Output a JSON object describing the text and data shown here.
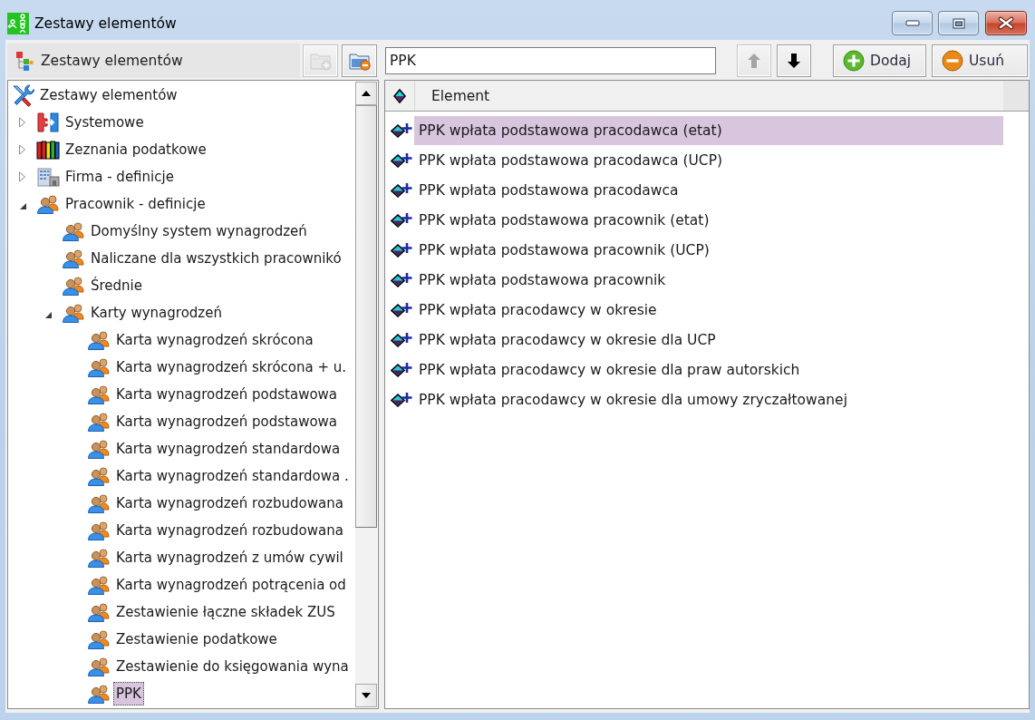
{
  "window": {
    "title": "Zestawy elementów"
  },
  "tree_panel": {
    "header": "Zestawy elementów",
    "buttons": [
      {
        "kind": "add",
        "disabled": true
      },
      {
        "kind": "remove",
        "disabled": false
      }
    ]
  },
  "tree": {
    "items": [
      {
        "label": "Zestawy elementów",
        "kind": "tools",
        "selected": false,
        "children": [
          {
            "label": "Systemowe",
            "kind": "system",
            "expanded": false,
            "selected": false
          },
          {
            "label": "Zeznania podatkowe",
            "kind": "books",
            "expanded": false,
            "selected": false
          },
          {
            "label": "Firma - definicje",
            "kind": "building",
            "expanded": false,
            "selected": false
          },
          {
            "label": "Pracownik - definicje",
            "kind": "people",
            "expanded": true,
            "selected": false,
            "children": [
              {
                "label": "Domyślny system wynagrodzeń",
                "kind": "people",
                "selected": false
              },
              {
                "label": "Naliczane dla wszystkich pracownikó",
                "kind": "people",
                "selected": false
              },
              {
                "label": "Średnie",
                "kind": "people",
                "selected": false
              },
              {
                "label": "Karty wynagrodzeń",
                "kind": "people",
                "expanded": true,
                "selected": false,
                "children": [
                  {
                    "label": "Karta wynagrodzeń skrócona",
                    "kind": "people",
                    "selected": false
                  },
                  {
                    "label": "Karta wynagrodzeń skrócona + u.",
                    "kind": "people",
                    "selected": false
                  },
                  {
                    "label": "Karta wynagrodzeń podstawowa",
                    "kind": "people",
                    "selected": false
                  },
                  {
                    "label": "Karta wynagrodzeń podstawowa",
                    "kind": "people",
                    "selected": false
                  },
                  {
                    "label": "Karta wynagrodzeń standardowa",
                    "kind": "people",
                    "selected": false
                  },
                  {
                    "label": "Karta wynagrodzeń standardowa .",
                    "kind": "people",
                    "selected": false
                  },
                  {
                    "label": "Karta wynagrodzeń rozbudowana",
                    "kind": "people",
                    "selected": false
                  },
                  {
                    "label": "Karta wynagrodzeń rozbudowana",
                    "kind": "people",
                    "selected": false
                  },
                  {
                    "label": "Karta wynagrodzeń z umów cywil",
                    "kind": "people",
                    "selected": false
                  },
                  {
                    "label": "Karta wynagrodzeń potrącenia od",
                    "kind": "people",
                    "selected": false
                  },
                  {
                    "label": "Zestawienie łączne składek ZUS",
                    "kind": "people",
                    "selected": false
                  },
                  {
                    "label": "Zestawienie podatkowe",
                    "kind": "people",
                    "selected": false
                  },
                  {
                    "label": "Zestawienie do księgowania wyna",
                    "kind": "people",
                    "selected": false
                  },
                  {
                    "label": "PPK",
                    "kind": "people",
                    "selected": true
                  }
                ]
              }
            ]
          }
        ]
      }
    ]
  },
  "toolbar": {
    "search": {
      "value": "PPK"
    },
    "move_buttons": [
      {
        "kind": "up",
        "disabled": true
      },
      {
        "kind": "down",
        "disabled": false
      }
    ],
    "buttons": [
      {
        "kind": "add",
        "label": "Dodaj"
      },
      {
        "kind": "remove",
        "label": "Usuń"
      }
    ]
  },
  "table": {
    "columns": [
      {
        "kind": "icon"
      },
      {
        "kind": "text",
        "label": "Element"
      }
    ],
    "rows": [
      {
        "label": "PPK wpłata podstawowa pracodawca (etat)",
        "selected": true
      },
      {
        "label": "PPK wpłata podstawowa pracodawca (UCP)",
        "selected": false
      },
      {
        "label": "PPK wpłata podstawowa pracodawca",
        "selected": false
      },
      {
        "label": "PPK wpłata podstawowa pracownik (etat)",
        "selected": false
      },
      {
        "label": "PPK wpłata podstawowa pracownik (UCP)",
        "selected": false
      },
      {
        "label": "PPK wpłata podstawowa pracownik",
        "selected": false
      },
      {
        "label": "PPK wpłata pracodawcy w okresie",
        "selected": false
      },
      {
        "label": "PPK wpłata pracodawcy w okresie dla UCP",
        "selected": false
      },
      {
        "label": "PPK wpłata pracodawcy w okresie dla praw autorskich",
        "selected": false
      },
      {
        "label": "PPK wpłata pracodawcy w okresie dla umowy zryczałtowanej",
        "selected": false
      }
    ]
  }
}
